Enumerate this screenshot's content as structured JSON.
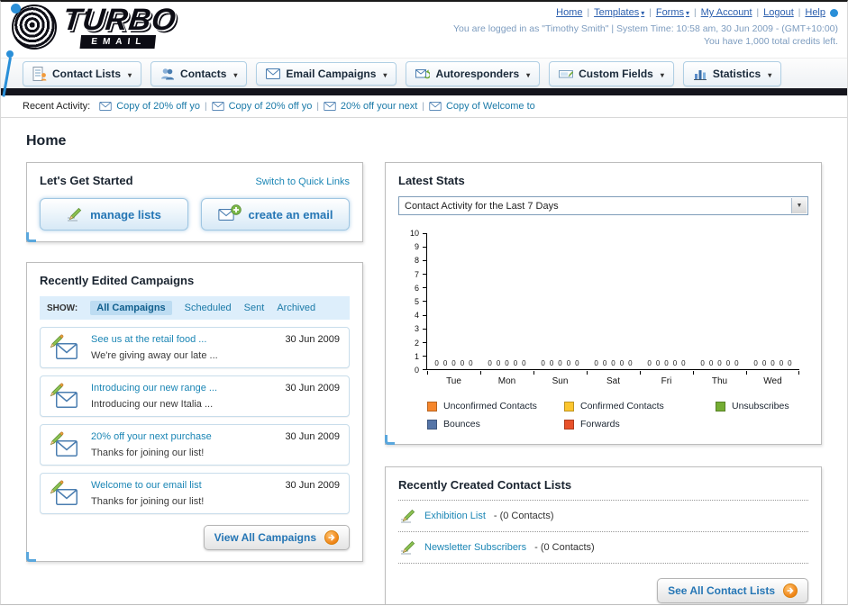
{
  "header": {
    "logo": {
      "title": "TURBO",
      "subtitle": "EMAIL"
    },
    "top_links": [
      {
        "label": "Home"
      },
      {
        "label": "Templates",
        "dropdown": true
      },
      {
        "label": "Forms",
        "dropdown": true
      },
      {
        "label": "My Account"
      },
      {
        "label": "Logout"
      },
      {
        "label": "Help"
      }
    ],
    "login_info": "You are logged in as \"Timothy Smith\" | System Time: 10:58 am, 30 Jun 2009 - (GMT+10:00)",
    "credits_info": "You have 1,000 total credits left."
  },
  "nav_tabs": [
    {
      "label": "Contact Lists"
    },
    {
      "label": "Contacts"
    },
    {
      "label": "Email Campaigns"
    },
    {
      "label": "Autoresponders"
    },
    {
      "label": "Custom Fields"
    },
    {
      "label": "Statistics"
    }
  ],
  "recent_activity": {
    "label": "Recent Activity:",
    "items": [
      {
        "label": "Copy of 20% off yo"
      },
      {
        "label": "Copy of 20% off yo"
      },
      {
        "label": "20% off your next"
      },
      {
        "label": "Copy of Welcome to"
      }
    ]
  },
  "page_title": "Home",
  "get_started": {
    "title": "Let's Get Started",
    "switch_link": "Switch to Quick Links",
    "buttons": [
      {
        "label": "manage lists"
      },
      {
        "label": "create an email"
      }
    ]
  },
  "campaigns": {
    "title": "Recently Edited Campaigns",
    "show_label": "SHOW:",
    "filters": [
      {
        "label": "All Campaigns",
        "selected": true
      },
      {
        "label": "Scheduled"
      },
      {
        "label": "Sent"
      },
      {
        "label": "Archived"
      }
    ],
    "items": [
      {
        "title": "See us at the retail food ...",
        "subtitle": "We're giving away our late ...",
        "date": "30 Jun 2009"
      },
      {
        "title": "Introducing our new range ...",
        "subtitle": "Introducing our new Italia ...",
        "date": "30 Jun 2009"
      },
      {
        "title": "20% off your next purchase",
        "subtitle": "Thanks for joining our list!",
        "date": "30 Jun 2009"
      },
      {
        "title": "Welcome to our email list",
        "subtitle": "Thanks for joining our list!",
        "date": "30 Jun 2009"
      }
    ],
    "view_all_label": "View All Campaigns"
  },
  "stats": {
    "title": "Latest Stats",
    "dropdown_value": "Contact Activity for the Last 7 Days",
    "legend": [
      {
        "label": "Unconfirmed Contacts",
        "color": "#f6862b"
      },
      {
        "label": "Confirmed Contacts",
        "color": "#fcc62e"
      },
      {
        "label": "Unsubscribes",
        "color": "#74ad33"
      },
      {
        "label": "Bounces",
        "color": "#5575a8"
      },
      {
        "label": "Forwards",
        "color": "#e8512a"
      }
    ]
  },
  "chart_data": {
    "type": "bar",
    "title": "Contact Activity for the Last 7 Days",
    "categories": [
      "Tue",
      "Mon",
      "Sun",
      "Sat",
      "Fri",
      "Thu",
      "Wed"
    ],
    "series": [
      {
        "name": "Unconfirmed Contacts",
        "color": "#f6862b",
        "values": [
          0,
          0,
          0,
          0,
          0,
          0,
          0
        ]
      },
      {
        "name": "Confirmed Contacts",
        "color": "#fcc62e",
        "values": [
          0,
          0,
          0,
          0,
          0,
          0,
          0
        ]
      },
      {
        "name": "Unsubscribes",
        "color": "#74ad33",
        "values": [
          0,
          0,
          0,
          0,
          0,
          0,
          0
        ]
      },
      {
        "name": "Bounces",
        "color": "#5575a8",
        "values": [
          0,
          0,
          0,
          0,
          0,
          0,
          0
        ]
      },
      {
        "name": "Forwards",
        "color": "#e8512a",
        "values": [
          0,
          0,
          0,
          0,
          0,
          0,
          0
        ]
      }
    ],
    "ylim": [
      0,
      10
    ],
    "yticks": [
      0,
      1,
      2,
      3,
      4,
      5,
      6,
      7,
      8,
      9,
      10
    ],
    "legend_position": "bottom",
    "grid": false
  },
  "contact_lists": {
    "title": "Recently Created Contact Lists",
    "items": [
      {
        "name": "Exhibition List",
        "detail": "- (0 Contacts)"
      },
      {
        "name": "Newsletter Subscribers",
        "detail": "- (0 Contacts)"
      }
    ],
    "see_all_label": "See All Contact Lists"
  }
}
